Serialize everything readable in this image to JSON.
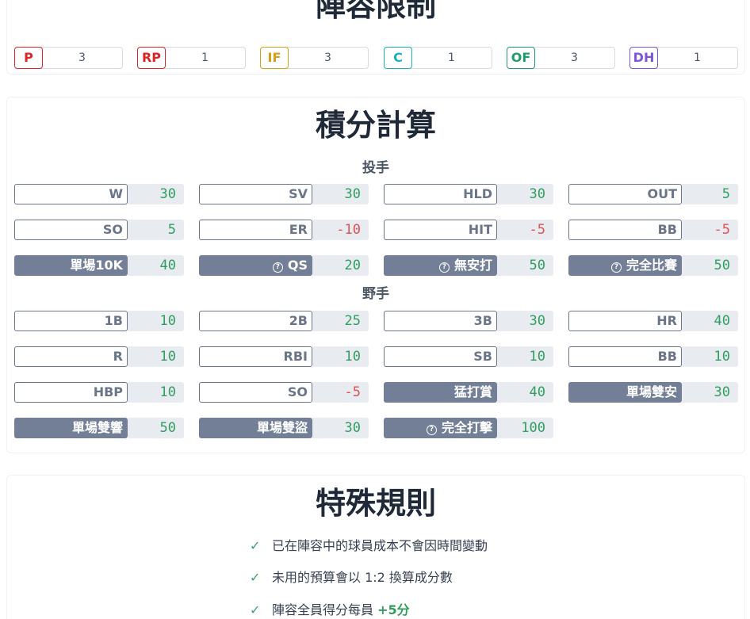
{
  "lineup": {
    "title": "陣容限制",
    "limits": [
      {
        "pos": "P",
        "count": "3",
        "color": "#dc2626"
      },
      {
        "pos": "RP",
        "count": "1",
        "color": "#dc2626"
      },
      {
        "pos": "IF",
        "count": "3",
        "color": "#d4a017"
      },
      {
        "pos": "C",
        "count": "1",
        "color": "#1bb0b8"
      },
      {
        "pos": "OF",
        "count": "3",
        "color": "#1f9d6b"
      },
      {
        "pos": "DH",
        "count": "1",
        "color": "#7c55d9"
      }
    ]
  },
  "scoring": {
    "title": "積分計算",
    "pitcher_label": "投手",
    "batter_label": "野手",
    "pitcher": [
      {
        "label": "W",
        "value": "30",
        "special": false,
        "info": false,
        "negative": false
      },
      {
        "label": "SV",
        "value": "30",
        "special": false,
        "info": false,
        "negative": false
      },
      {
        "label": "HLD",
        "value": "30",
        "special": false,
        "info": false,
        "negative": false
      },
      {
        "label": "OUT",
        "value": "5",
        "special": false,
        "info": false,
        "negative": false
      },
      {
        "label": "SO",
        "value": "5",
        "special": false,
        "info": false,
        "negative": false
      },
      {
        "label": "ER",
        "value": "-10",
        "special": false,
        "info": false,
        "negative": true
      },
      {
        "label": "HIT",
        "value": "-5",
        "special": false,
        "info": false,
        "negative": true
      },
      {
        "label": "BB",
        "value": "-5",
        "special": false,
        "info": false,
        "negative": true
      },
      {
        "label": "單場10K",
        "value": "40",
        "special": true,
        "info": false,
        "negative": false
      },
      {
        "label": "QS",
        "value": "20",
        "special": true,
        "info": true,
        "negative": false
      },
      {
        "label": "無安打",
        "value": "50",
        "special": true,
        "info": true,
        "negative": false
      },
      {
        "label": "完全比賽",
        "value": "50",
        "special": true,
        "info": true,
        "negative": false
      }
    ],
    "batter": [
      {
        "label": "1B",
        "value": "10",
        "special": false,
        "info": false,
        "negative": false
      },
      {
        "label": "2B",
        "value": "25",
        "special": false,
        "info": false,
        "negative": false
      },
      {
        "label": "3B",
        "value": "30",
        "special": false,
        "info": false,
        "negative": false
      },
      {
        "label": "HR",
        "value": "40",
        "special": false,
        "info": false,
        "negative": false
      },
      {
        "label": "R",
        "value": "10",
        "special": false,
        "info": false,
        "negative": false
      },
      {
        "label": "RBI",
        "value": "10",
        "special": false,
        "info": false,
        "negative": false
      },
      {
        "label": "SB",
        "value": "10",
        "special": false,
        "info": false,
        "negative": false
      },
      {
        "label": "BB",
        "value": "10",
        "special": false,
        "info": false,
        "negative": false
      },
      {
        "label": "HBP",
        "value": "10",
        "special": false,
        "info": false,
        "negative": false
      },
      {
        "label": "SO",
        "value": "-5",
        "special": false,
        "info": false,
        "negative": true
      },
      {
        "label": "猛打賞",
        "value": "40",
        "special": true,
        "info": false,
        "negative": false
      },
      {
        "label": "單場雙安",
        "value": "30",
        "special": true,
        "info": false,
        "negative": false
      },
      {
        "label": "單場雙響",
        "value": "50",
        "special": true,
        "info": false,
        "negative": false
      },
      {
        "label": "單場雙盜",
        "value": "30",
        "special": true,
        "info": false,
        "negative": false
      },
      {
        "label": "完全打擊",
        "value": "100",
        "special": true,
        "info": true,
        "negative": false
      }
    ]
  },
  "rules": {
    "title": "特殊規則",
    "items": [
      {
        "text": "已在陣容中的球員成本不會因時間變動",
        "highlight": ""
      },
      {
        "text": "未用的預算會以 1:2 換算成分數",
        "highlight": ""
      },
      {
        "text": "陣容全員得分每員 ",
        "highlight": "+5分"
      }
    ]
  },
  "colors": {
    "positive": "#2f9e5f",
    "negative": "#e05252",
    "label_border": "#6b7588",
    "special_bg": "#737f96",
    "value_bg": "#e8ebf0"
  }
}
